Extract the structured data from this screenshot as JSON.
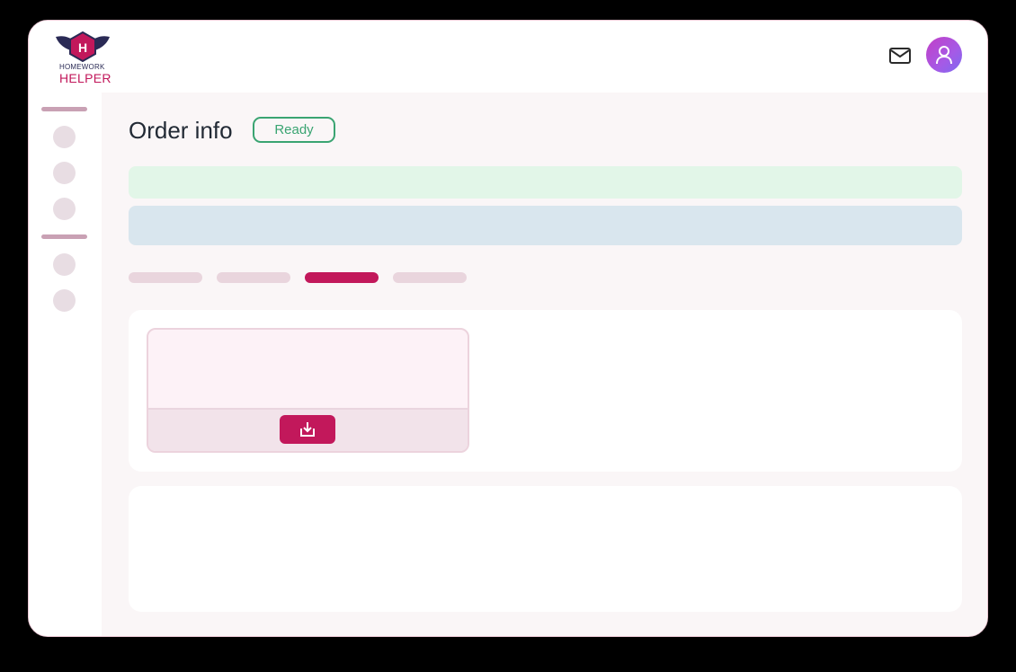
{
  "app": {
    "logo_line1": "HOMEWORK",
    "logo_line2": "HELPER",
    "logo_letter": "H"
  },
  "header": {
    "icons": [
      "mail-icon",
      "user-icon"
    ]
  },
  "sidebar": {
    "items": [
      "nav-item-1",
      "nav-item-2",
      "nav-item-3",
      "nav-item-4",
      "nav-item-5"
    ]
  },
  "main": {
    "title": "Order info",
    "status": "Ready",
    "tabs_active_index": 2
  },
  "file": {
    "action_icon": "download-icon"
  },
  "colors": {
    "accent": "#c2185b",
    "status_green": "#3aa472",
    "banner_green": "#e2f6e8",
    "banner_blue": "#d9e6ee"
  }
}
